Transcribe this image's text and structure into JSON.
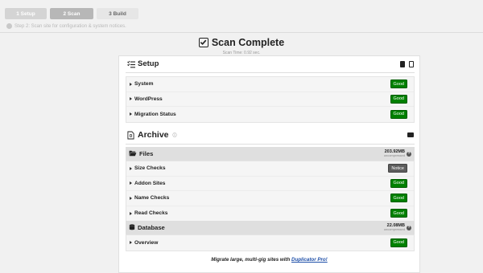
{
  "steps": [
    {
      "label": "1 Setup",
      "state": "done"
    },
    {
      "label": "2 Scan",
      "state": "active"
    },
    {
      "label": "3 Build",
      "state": "pending"
    }
  ],
  "step_hint": "Step 2: Scan site for configuration & system notices.",
  "title": "Scan Complete",
  "scan_time": "Scan Time: 0.92 sec.",
  "setup": {
    "title": "Setup",
    "rows": [
      {
        "label": "System",
        "status": "Good"
      },
      {
        "label": "WordPress",
        "status": "Good"
      },
      {
        "label": "Migration Status",
        "status": "Good"
      }
    ]
  },
  "archive": {
    "title": "Archive",
    "files": {
      "title": "Files",
      "size": "203.92MB",
      "size_note": "uncompressed",
      "rows": [
        {
          "label": "Size Checks",
          "status": "Notice"
        },
        {
          "label": "Addon Sites",
          "status": "Good"
        },
        {
          "label": "Name Checks",
          "status": "Good"
        },
        {
          "label": "Read Checks",
          "status": "Good"
        }
      ]
    },
    "database": {
      "title": "Database",
      "size": "22.08MB",
      "size_note": "uncompressed",
      "rows": [
        {
          "label": "Overview",
          "status": "Good"
        }
      ]
    }
  },
  "promo": {
    "text": "Migrate large, multi-gig sites with",
    "link": "Duplicator Pro!"
  },
  "colors": {
    "good": "#008000",
    "notice": "#5d5d5d",
    "link": "#1e4fa8"
  }
}
